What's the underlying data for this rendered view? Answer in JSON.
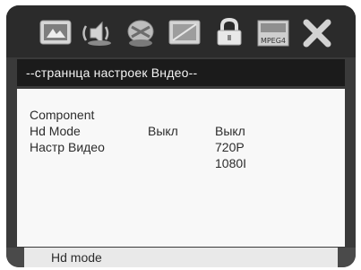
{
  "toolbar": {
    "icons": [
      "system-setup-icon",
      "audio-setup-icon",
      "disc-icon",
      "video-setup-icon",
      "lock-icon",
      "mpeg-info-icon",
      "exit-icon"
    ],
    "mpeg_label": "MPEG4"
  },
  "menu": {
    "title": "--страннца настроек Вндео--"
  },
  "settings": {
    "rows": [
      {
        "label": "Component",
        "value": ""
      },
      {
        "label": "Hd Mode",
        "value": "Выкл"
      },
      {
        "label": "Настр Видео",
        "value": ""
      }
    ],
    "options": [
      "Выкл",
      "720P",
      "1080I"
    ]
  },
  "status": {
    "text": "Hd mode"
  }
}
